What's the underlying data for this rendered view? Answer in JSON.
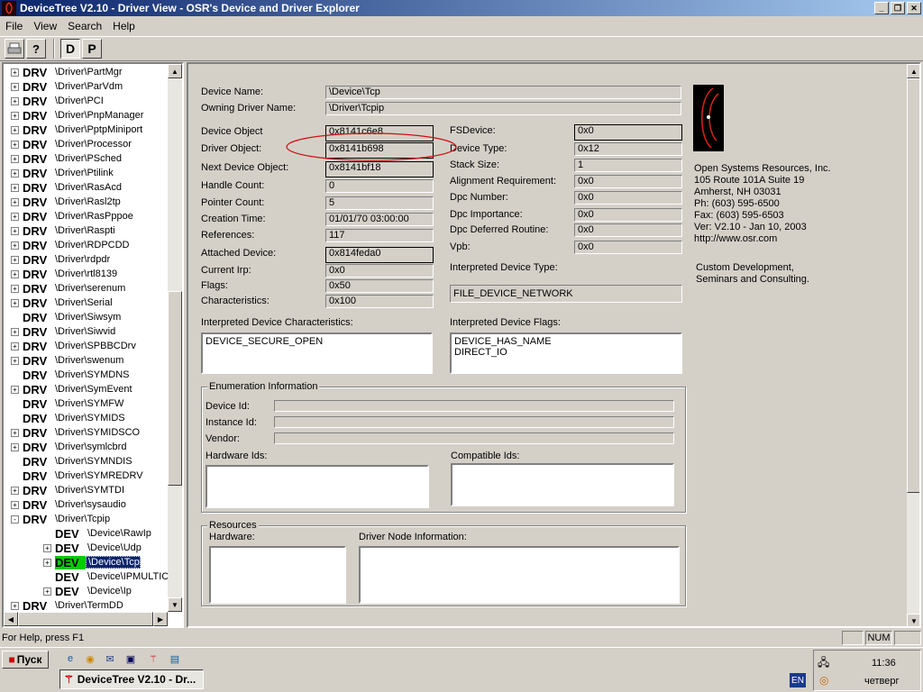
{
  "window": {
    "title": "DeviceTree V2.10 - Driver View - OSR's Device and Driver Explorer"
  },
  "menu": [
    "File",
    "View",
    "Search",
    "Help"
  ],
  "toolbar": {
    "d_label": "D",
    "p_label": "P"
  },
  "tree": [
    {
      "tag": "DRV",
      "label": "\\Driver\\PartMgr",
      "exp": "+",
      "indent": 0
    },
    {
      "tag": "DRV",
      "label": "\\Driver\\ParVdm",
      "exp": "+",
      "indent": 0
    },
    {
      "tag": "DRV",
      "label": "\\Driver\\PCI",
      "exp": "+",
      "indent": 0
    },
    {
      "tag": "DRV",
      "label": "\\Driver\\PnpManager",
      "exp": "+",
      "indent": 0
    },
    {
      "tag": "DRV",
      "label": "\\Driver\\PptpMiniport",
      "exp": "+",
      "indent": 0
    },
    {
      "tag": "DRV",
      "label": "\\Driver\\Processor",
      "exp": "+",
      "indent": 0
    },
    {
      "tag": "DRV",
      "label": "\\Driver\\PSched",
      "exp": "+",
      "indent": 0
    },
    {
      "tag": "DRV",
      "label": "\\Driver\\Ptilink",
      "exp": "+",
      "indent": 0
    },
    {
      "tag": "DRV",
      "label": "\\Driver\\RasAcd",
      "exp": "+",
      "indent": 0
    },
    {
      "tag": "DRV",
      "label": "\\Driver\\Rasl2tp",
      "exp": "+",
      "indent": 0
    },
    {
      "tag": "DRV",
      "label": "\\Driver\\RasPppoe",
      "exp": "+",
      "indent": 0
    },
    {
      "tag": "DRV",
      "label": "\\Driver\\Raspti",
      "exp": "+",
      "indent": 0
    },
    {
      "tag": "DRV",
      "label": "\\Driver\\RDPCDD",
      "exp": "+",
      "indent": 0
    },
    {
      "tag": "DRV",
      "label": "\\Driver\\rdpdr",
      "exp": "+",
      "indent": 0
    },
    {
      "tag": "DRV",
      "label": "\\Driver\\rtl8139",
      "exp": "+",
      "indent": 0
    },
    {
      "tag": "DRV",
      "label": "\\Driver\\serenum",
      "exp": "+",
      "indent": 0
    },
    {
      "tag": "DRV",
      "label": "\\Driver\\Serial",
      "exp": "+",
      "indent": 0
    },
    {
      "tag": "DRV",
      "label": "\\Driver\\Siwsym",
      "exp": "",
      "indent": 0
    },
    {
      "tag": "DRV",
      "label": "\\Driver\\Siwvid",
      "exp": "+",
      "indent": 0
    },
    {
      "tag": "DRV",
      "label": "\\Driver\\SPBBCDrv",
      "exp": "+",
      "indent": 0
    },
    {
      "tag": "DRV",
      "label": "\\Driver\\swenum",
      "exp": "+",
      "indent": 0
    },
    {
      "tag": "DRV",
      "label": "\\Driver\\SYMDNS",
      "exp": "",
      "indent": 0
    },
    {
      "tag": "DRV",
      "label": "\\Driver\\SymEvent",
      "exp": "+",
      "indent": 0
    },
    {
      "tag": "DRV",
      "label": "\\Driver\\SYMFW",
      "exp": "",
      "indent": 0
    },
    {
      "tag": "DRV",
      "label": "\\Driver\\SYMIDS",
      "exp": "",
      "indent": 0
    },
    {
      "tag": "DRV",
      "label": "\\Driver\\SYMIDSCO",
      "exp": "+",
      "indent": 0
    },
    {
      "tag": "DRV",
      "label": "\\Driver\\symlcbrd",
      "exp": "+",
      "indent": 0
    },
    {
      "tag": "DRV",
      "label": "\\Driver\\SYMNDIS",
      "exp": "",
      "indent": 0
    },
    {
      "tag": "DRV",
      "label": "\\Driver\\SYMREDRV",
      "exp": "",
      "indent": 0
    },
    {
      "tag": "DRV",
      "label": "\\Driver\\SYMTDI",
      "exp": "+",
      "indent": 0
    },
    {
      "tag": "DRV",
      "label": "\\Driver\\sysaudio",
      "exp": "+",
      "indent": 0
    },
    {
      "tag": "DRV",
      "label": "\\Driver\\Tcpip",
      "exp": "-",
      "indent": 0
    },
    {
      "tag": "DEV",
      "label": "\\Device\\RawIp",
      "exp": "",
      "indent": 1
    },
    {
      "tag": "DEV",
      "label": "\\Device\\Udp",
      "exp": "+",
      "indent": 1
    },
    {
      "tag": "DEV",
      "label": "\\Device\\Tcp",
      "exp": "+",
      "indent": 1,
      "selected": true
    },
    {
      "tag": "DEV",
      "label": "\\Device\\IPMULTICAST",
      "exp": "",
      "indent": 1
    },
    {
      "tag": "DEV",
      "label": "\\Device\\Ip",
      "exp": "+",
      "indent": 1
    },
    {
      "tag": "DRV",
      "label": "\\Driver\\TermDD",
      "exp": "+",
      "indent": 0
    }
  ],
  "device": {
    "device_name_label": "Device Name:",
    "device_name": "\\Device\\Tcp",
    "owning_driver_label": "Owning Driver Name:",
    "owning_driver": "\\Driver\\Tcpip",
    "left": [
      {
        "label": "Device Object",
        "value": "0x8141c6e8",
        "box": true
      },
      {
        "label": "Driver Object:",
        "value": "0x8141b698",
        "box": true
      },
      {
        "label": "Next Device Object:",
        "value": "0x8141bf18",
        "box": true
      },
      {
        "label": "Handle Count:",
        "value": "0",
        "box": false
      },
      {
        "label": "Pointer Count:",
        "value": "5",
        "box": false
      },
      {
        "label": "Creation Time:",
        "value": "01/01/70 03:00:00",
        "box": false
      },
      {
        "label": "References:",
        "value": "117",
        "box": false
      },
      {
        "label": "Attached Device:",
        "value": "0x814feda0",
        "box": true
      },
      {
        "label": "Current Irp:",
        "value": "0x0",
        "box": false
      },
      {
        "label": "Flags:",
        "value": "0x50",
        "box": false
      },
      {
        "label": "Characteristics:",
        "value": "0x100",
        "box": false
      }
    ],
    "right": [
      {
        "label": "FSDevice:",
        "value": "0x0",
        "box": true
      },
      {
        "label": "Device Type:",
        "value": "0x12",
        "box": false
      },
      {
        "label": "Stack Size:",
        "value": "1",
        "box": false
      },
      {
        "label": "Alignment Requirement:",
        "value": "0x0",
        "box": false
      },
      {
        "label": "Dpc Number:",
        "value": "0x0",
        "box": false
      },
      {
        "label": "Dpc Importance:",
        "value": "0x0",
        "box": false
      },
      {
        "label": "Dpc Deferred Routine:",
        "value": "0x0",
        "box": false
      },
      {
        "label": "Vpb:",
        "value": "0x0",
        "box": false
      }
    ],
    "interp_type_label": "Interpreted Device Type:",
    "interp_type": "FILE_DEVICE_NETWORK",
    "interp_chars_label": "Interpreted Device Characteristics:",
    "interp_chars": "DEVICE_SECURE_OPEN",
    "interp_flags_label": "Interpreted Device Flags:",
    "interp_flags": [
      "DEVICE_HAS_NAME",
      "DIRECT_IO"
    ]
  },
  "osr": {
    "lines": [
      "Open Systems Resources, Inc.",
      "105 Route 101A Suite 19",
      "Amherst, NH 03031",
      "Ph: (603) 595-6500",
      "Fax: (603) 595-6503",
      "Ver: V2.10 - Jan 10, 2003",
      "http://www.osr.com"
    ],
    "tagline": [
      "Custom Development,",
      "Seminars and Consulting."
    ]
  },
  "enumeration": {
    "title": "Enumeration Information",
    "device_id_label": "Device Id:",
    "instance_id_label": "Instance Id:",
    "vendor_label": "Vendor:",
    "hardware_ids_label": "Hardware Ids:",
    "compatible_ids_label": "Compatible Ids:"
  },
  "resources": {
    "title": "Resources",
    "hardware_label": "Hardware:",
    "driver_node_label": "Driver Node Information:"
  },
  "status": {
    "message": "For Help, press F1",
    "num": "NUM"
  },
  "taskbar": {
    "start": "Пуск",
    "task": "DeviceTree V2.10 - Dr...",
    "lang": "EN",
    "time": "11:36",
    "day": "четверг"
  }
}
